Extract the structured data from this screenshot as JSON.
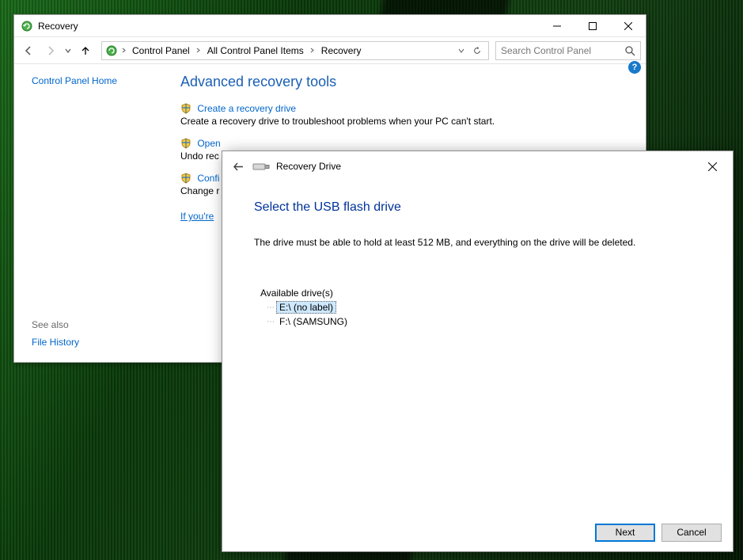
{
  "cp": {
    "title": "Recovery",
    "breadcrumb": [
      "Control Panel",
      "All Control Panel Items",
      "Recovery"
    ],
    "search_placeholder": "Search Control Panel",
    "sidebar_home": "Control Panel Home",
    "heading": "Advanced recovery tools",
    "tools": [
      {
        "link": "Create a recovery drive",
        "desc": "Create a recovery drive to troubleshoot problems when your PC can't start."
      },
      {
        "link": "Open",
        "desc": "Undo rec"
      },
      {
        "link": "Confi",
        "desc": "Change r"
      }
    ],
    "find_link": "If you're",
    "seealso_label": "See also",
    "seealso_link": "File History"
  },
  "wizard": {
    "title": "Recovery Drive",
    "heading": "Select the USB flash drive",
    "text": "The drive must be able to hold at least 512 MB, and everything on the drive will be deleted.",
    "available_label": "Available drive(s)",
    "drives": [
      {
        "label": "E:\\ (no label)",
        "selected": true
      },
      {
        "label": "F:\\ (SAMSUNG)",
        "selected": false
      }
    ],
    "btn_next": "Next",
    "btn_cancel": "Cancel"
  }
}
